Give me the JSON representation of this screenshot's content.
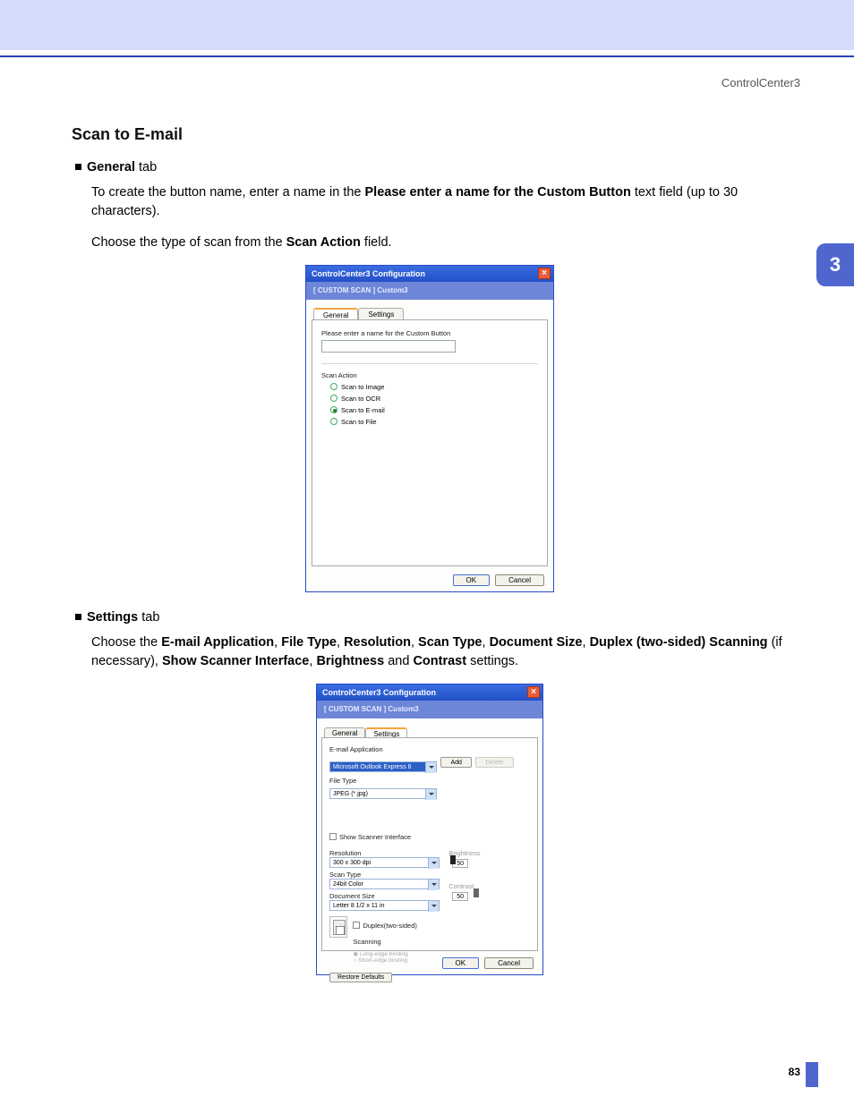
{
  "header": {
    "breadcrumb": "ControlCenter3",
    "chapter": "3"
  },
  "title": "Scan to E-mail",
  "bullets": {
    "general": "General",
    "tab": " tab",
    "settings": "Settings"
  },
  "para1_a": "To create the button name, enter a name in the ",
  "para1_b": "Please enter a name for the Custom Button",
  "para1_c": " text field (up to 30 characters).",
  "para2_a": "Choose the type of scan from the ",
  "para2_b": "Scan Action",
  "para2_c": " field.",
  "para3": {
    "a": "Choose the ",
    "b": "E-mail Application",
    "c": ", ",
    "d": "File Type",
    "e": ", ",
    "f": "Resolution",
    "g": ", ",
    "h": "Scan Type",
    "i": ", ",
    "j": "Document Size",
    "k": ", ",
    "l": "Duplex (two-sided) Scanning",
    "m": " (if necessary), ",
    "n": "Show Scanner Interface",
    "o": ", ",
    "p": "Brightness",
    "q": " and ",
    "r": "Contrast",
    "s": " settings."
  },
  "dlg": {
    "title": "ControlCenter3 Configuration",
    "crumb": "[  CUSTOM SCAN  ]   Custom3",
    "tab_general": "General",
    "tab_settings": "Settings",
    "name_label": "Please enter a name for the Custom Button",
    "scan_action": "Scan Action",
    "radios": [
      "Scan to Image",
      "Scan to OCR",
      "Scan to E-mail",
      "Scan to File"
    ],
    "ok": "OK",
    "cancel": "Cancel"
  },
  "dlg2": {
    "email_app_lbl": "E-mail Application",
    "email_app_val": "Microsoft Outlook Express 6",
    "add": "Add",
    "delete": "Delete",
    "file_type_lbl": "File Type",
    "file_type_val": "JPEG (*.jpg)",
    "show_scanner": "Show Scanner Interface",
    "resolution_lbl": "Resolution",
    "resolution_val": "300 x 300 dpi",
    "scan_type_lbl": "Scan Type",
    "scan_type_val": "24bit Color",
    "doc_size_lbl": "Document Size",
    "doc_size_val": "Letter 8 1/2 x 11 in",
    "brightness_lbl": "Brightness",
    "brightness_val": "50",
    "contrast_lbl": "Contrast",
    "contrast_val": "50",
    "duplex": "Duplex(two-sided) Scanning",
    "long_edge": "Long-edge binding",
    "short_edge": "Short-edge binding",
    "restore": "Restore Defaults"
  },
  "pagenum": "83"
}
